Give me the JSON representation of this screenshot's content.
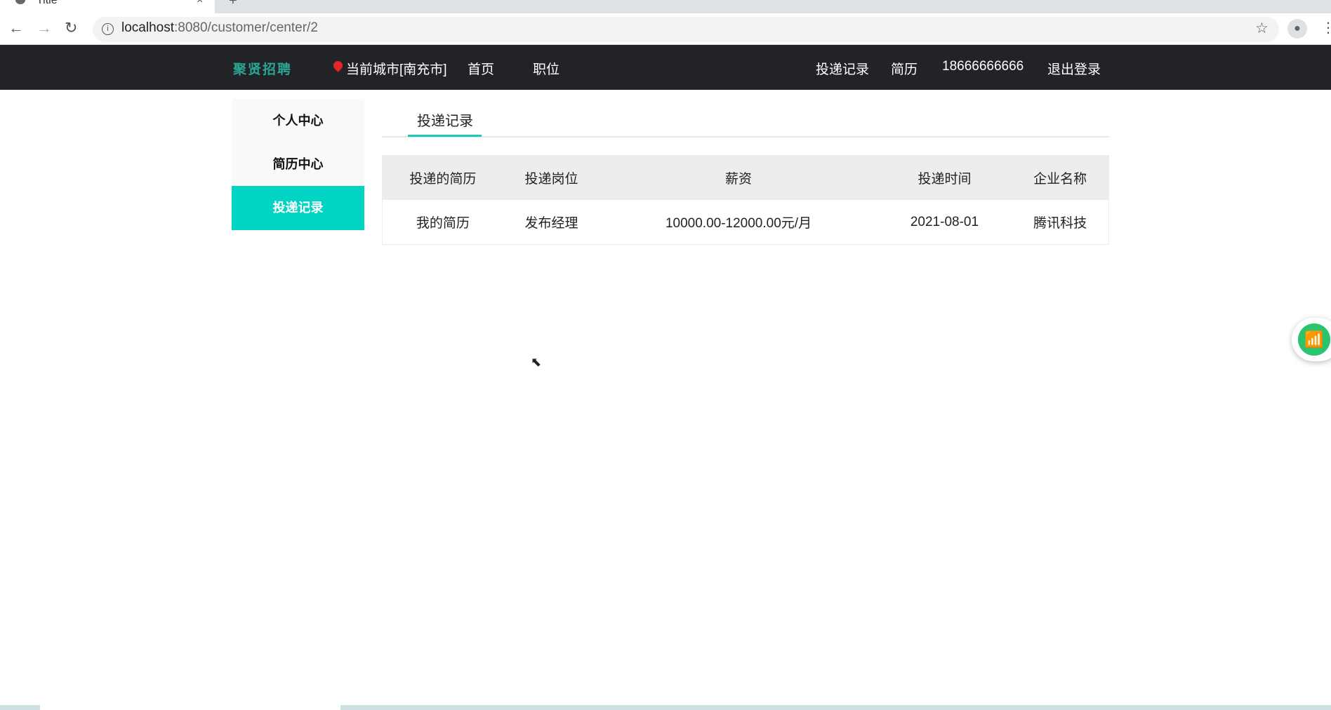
{
  "browser": {
    "tab_title": "Title",
    "url_host": "localhost",
    "url_path": ":8080/customer/center/2"
  },
  "nav": {
    "logo": "聚贤招聘",
    "city": "当前城市[南充市]",
    "home": "首页",
    "jobs": "职位",
    "records": "投递记录",
    "resume": "简历",
    "phone": "18666666666",
    "logout": "退出登录"
  },
  "sidebar": {
    "items": [
      {
        "label": "个人中心"
      },
      {
        "label": "简历中心"
      },
      {
        "label": "投递记录"
      }
    ]
  },
  "main": {
    "tab": "投递记录",
    "table": {
      "headers": [
        "投递的简历",
        "投递岗位",
        "薪资",
        "投递时间",
        "企业名称"
      ],
      "rows": [
        [
          "我的简历",
          "发布经理",
          "10000.00-12000.00元/月",
          "2021-08-01",
          "腾讯科技"
        ]
      ]
    }
  },
  "colors": {
    "accent": "#00d5c3",
    "nav_bg": "#212327"
  }
}
